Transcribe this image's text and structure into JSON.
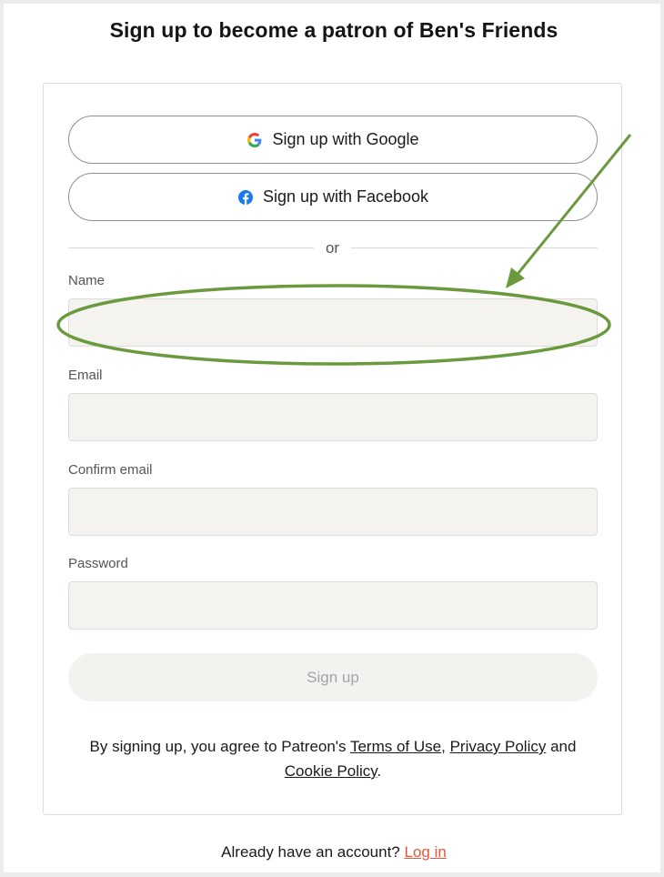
{
  "header": {
    "title": "Sign up to become a patron of Ben's Friends"
  },
  "social": {
    "google_label": "Sign up with Google",
    "facebook_label": "Sign up with Facebook",
    "google_icon": "google-g-icon",
    "facebook_icon": "facebook-f-icon"
  },
  "divider": {
    "text": "or"
  },
  "form": {
    "name_label": "Name",
    "name_value": "",
    "email_label": "Email",
    "email_value": "",
    "confirm_email_label": "Confirm email",
    "confirm_email_value": "",
    "password_label": "Password",
    "password_value": "",
    "submit_label": "Sign up"
  },
  "legal": {
    "prefix": "By signing up, you agree to Patreon's ",
    "terms": "Terms of Use",
    "comma": ", ",
    "privacy": "Privacy Policy",
    "and": " and ",
    "cookie": "Cookie Policy",
    "period": "."
  },
  "footer": {
    "prompt": "Already have an account? ",
    "login_label": "Log in"
  },
  "colors": {
    "link_accent": "#e8543c",
    "annotation_green": "#6a9a3d",
    "input_bg": "#f4f3f0"
  }
}
